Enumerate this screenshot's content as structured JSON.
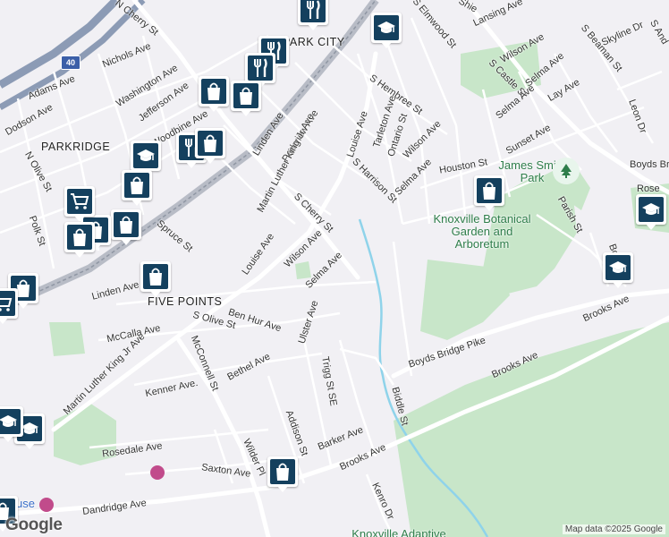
{
  "map": {
    "logo_text": "Google",
    "attribution": "Map data ©2025 Google",
    "colors": {
      "background": "#f1f0f4",
      "road": "#ffffff",
      "park": "#c8e6c9",
      "water": "#8fd3ea",
      "highway": "#8c9bb5",
      "rail": "#9aa0ac",
      "pin": "#14405e"
    },
    "neighborhoods": {
      "park_city": "PARK CITY",
      "parkridge": "PARKRIDGE",
      "five_points": "FIVE POINTS"
    },
    "highway_shield": "40",
    "parks": {
      "james_smith": "James Smith Park",
      "botanical": "Knoxville Botanical Garden and Arboretum",
      "adaptive": "Knoxville Adaptive"
    },
    "streets": {
      "n_cherry": "N Cherry St",
      "nichols": "Nichols Ave",
      "adams": "Adams Ave",
      "washington": "Washington Ave",
      "jefferson": "Jefferson Ave",
      "dodson": "Dodson Ave",
      "woodbine": "Woodbine Ave",
      "n_olive": "N Olive St",
      "polk": "Polk St",
      "spruce": "Spruce St",
      "linden_w": "Linden Ave",
      "linden_n": "Linden Ave",
      "parkview": "Parkview Ave",
      "mlk_n": "Martin Luther King Jr Ave",
      "mlk_s": "Martin Luther King Jr Ave",
      "louise_w": "Louise Ave",
      "louise_n": "Louise Ave",
      "s_cherry": "S Cherry St",
      "wilson_w": "Wilson Ave",
      "selma_w": "Selma Ave",
      "ben_hur": "Ben Hur Ave",
      "s_olive": "S Olive St",
      "mccalla": "McCalla Ave",
      "ulster": "Ulster Ave",
      "mcconnell": "McConnell St",
      "kenner": "Kenner Ave.",
      "bethel": "Bethel Ave",
      "trigg": "Trigg St SE",
      "addison": "Addison St",
      "barker": "Barker Ave",
      "rosedale": "Rosedale Ave",
      "saxton": "Saxton Ave",
      "wilder": "Wilder Pl",
      "dandridge": "Dandridge Ave",
      "brooks_s": "Brooks Ave",
      "brooks_m": "Brooks Ave",
      "brooks_e": "Brooks Ave",
      "biddle": "Biddle St",
      "boyds_pike": "Boyds Bridge Pike",
      "kenro": "Kenro Dr",
      "s_elmwood": "S Elmwood St",
      "s_hembree": "S Hembree St",
      "tarleton": "Tarleton Ave",
      "ontario": "Ontario St",
      "wilson_e": "Wilson Ave",
      "s_harrison": "S Harrison St",
      "selma_e": "Selma Ave",
      "houston": "Houston St",
      "s_castle": "S Castle St",
      "wilson_ne": "Wilson Ave",
      "selma_ne": "Selma Ave",
      "s_beaman": "S Beaman St",
      "lay": "Lay Ave",
      "skyline": "Skyline Dr",
      "sunset": "Sunset Ave",
      "leon": "Leon Dr",
      "parish": "Parish St",
      "boyds_br": "Boyds Br",
      "lansing": "Lansing Ave",
      "s_and": "S And",
      "bore": "Bore",
      "rose": "Rose",
      "shie": "Shie",
      "fragment_use": "use"
    },
    "pins": [
      {
        "name": "restaurant-pin-1",
        "icon": "fork-knife-icon"
      },
      {
        "name": "restaurant-pin-2",
        "icon": "fork-knife-icon"
      },
      {
        "name": "restaurant-pin-3",
        "icon": "fork-knife-icon"
      },
      {
        "name": "restaurant-pin-4",
        "icon": "fork-knife-icon"
      },
      {
        "name": "school-pin-1",
        "icon": "graduation-cap-icon"
      },
      {
        "name": "school-pin-2",
        "icon": "graduation-cap-icon"
      },
      {
        "name": "school-pin-3",
        "icon": "graduation-cap-icon"
      },
      {
        "name": "school-pin-4",
        "icon": "graduation-cap-icon"
      },
      {
        "name": "school-pin-5",
        "icon": "graduation-cap-icon"
      },
      {
        "name": "school-pin-6",
        "icon": "graduation-cap-icon"
      },
      {
        "name": "shopping-pin-1",
        "icon": "shopping-bag-icon"
      },
      {
        "name": "grocery-pin-1",
        "icon": "shopping-cart-icon"
      }
    ]
  }
}
